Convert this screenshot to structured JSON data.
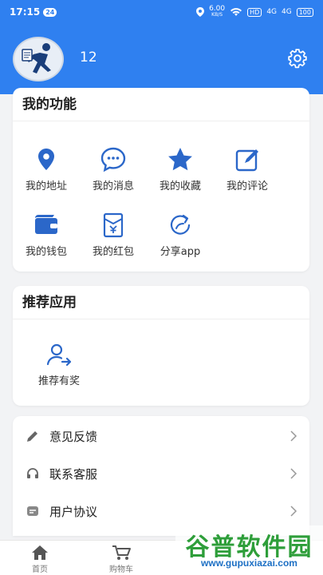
{
  "status_bar": {
    "time": "17:15",
    "badge": "24",
    "speed_top": "6.00",
    "speed_bottom": "KB/S",
    "hd": "HD",
    "signal1": "4G",
    "signal2": "4G",
    "battery": "100"
  },
  "profile": {
    "username": "12"
  },
  "functions": {
    "title": "我的功能",
    "items": [
      {
        "label": "我的地址",
        "icon": "location-pin-icon"
      },
      {
        "label": "我的消息",
        "icon": "chat-bubble-icon"
      },
      {
        "label": "我的收藏",
        "icon": "star-icon"
      },
      {
        "label": "我的评论",
        "icon": "edit-icon"
      },
      {
        "label": "我的钱包",
        "icon": "wallet-icon"
      },
      {
        "label": "我的红包",
        "icon": "red-envelope-icon"
      },
      {
        "label": "分享app",
        "icon": "share-icon"
      }
    ]
  },
  "recommend": {
    "title": "推荐应用",
    "items": [
      {
        "label": "推荐有奖",
        "icon": "add-user-icon"
      }
    ]
  },
  "list": {
    "items": [
      {
        "label": "意见反馈",
        "icon": "pencil-icon"
      },
      {
        "label": "联系客服",
        "icon": "headset-icon"
      },
      {
        "label": "用户协议",
        "icon": "document-icon"
      }
    ]
  },
  "tabbar": {
    "items": [
      {
        "label": "首页",
        "icon": "home-icon"
      },
      {
        "label": "购物车",
        "icon": "cart-icon"
      }
    ]
  },
  "watermark": {
    "text": "谷普软件园",
    "url": "www.gupuxiazai.com"
  },
  "colors": {
    "primary": "#2f80f0",
    "background": "#f2f3f5"
  }
}
